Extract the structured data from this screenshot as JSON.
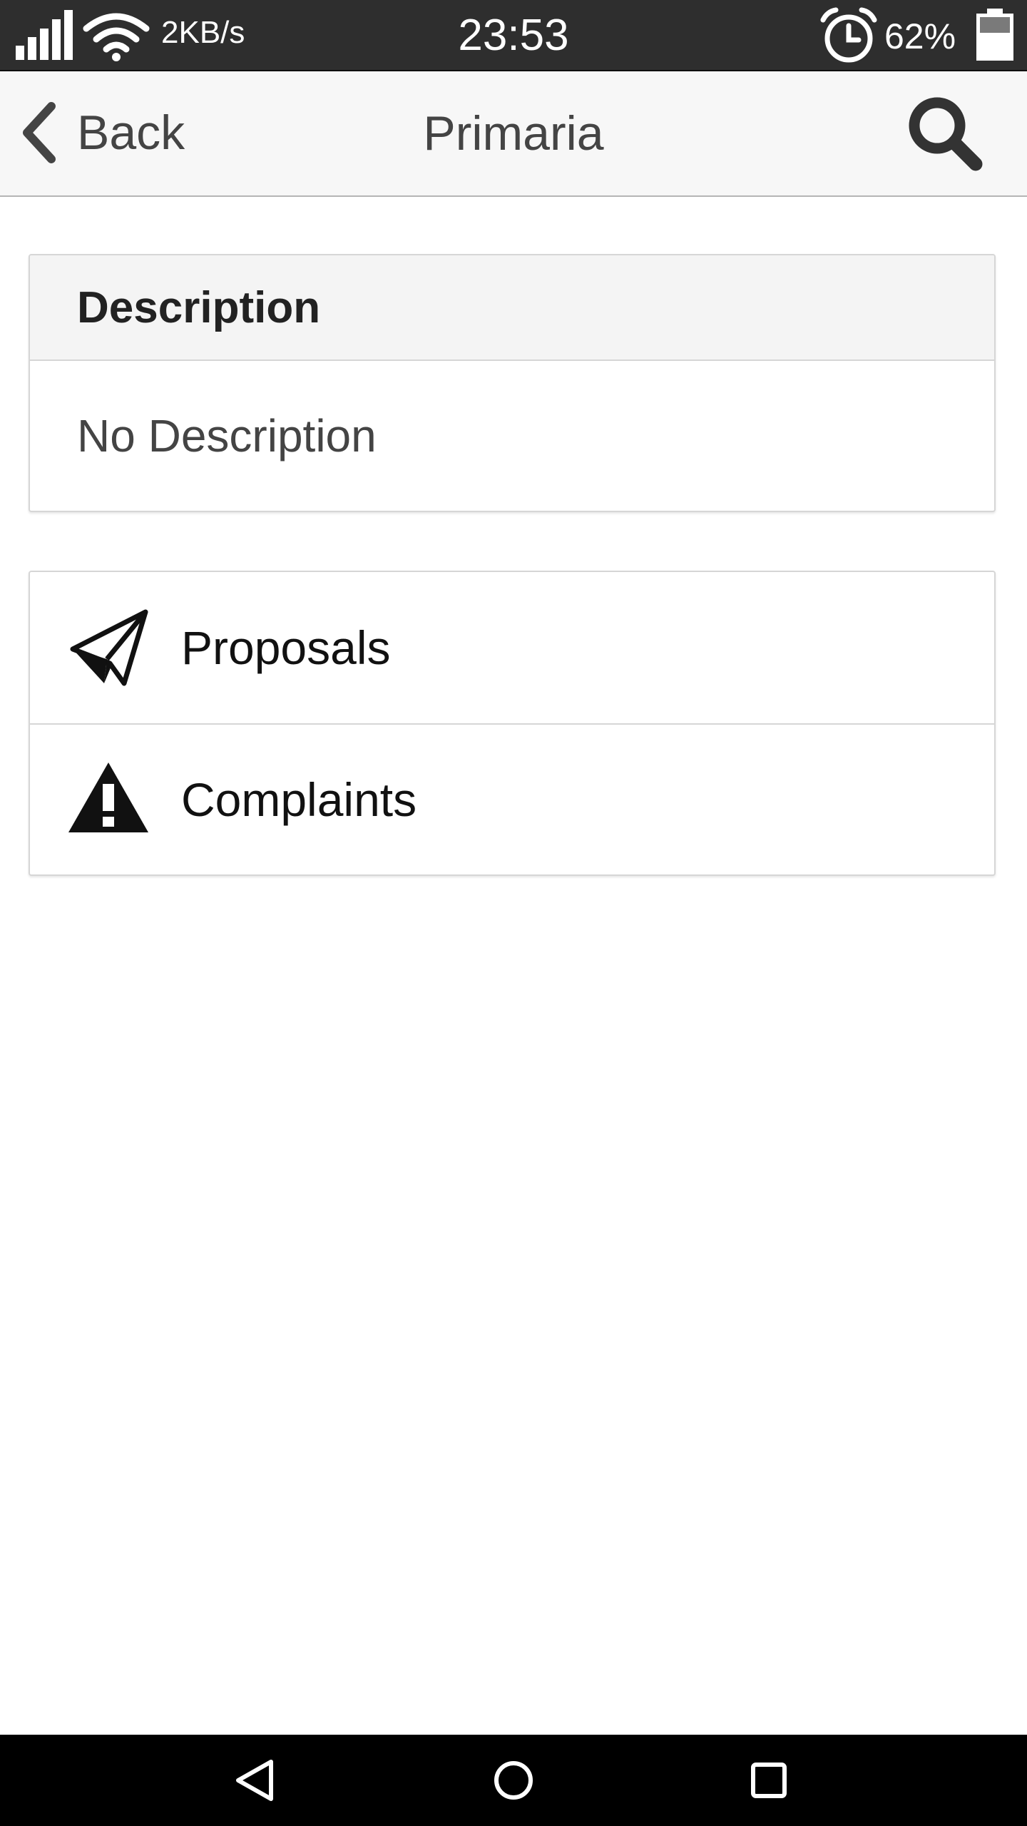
{
  "status_bar": {
    "net_speed": "2KB/s",
    "time": "23:53",
    "battery_percent": "62%",
    "icons": [
      "signal-icon",
      "wifi-icon",
      "alarm-clock-icon",
      "battery-icon"
    ]
  },
  "header": {
    "back_label": "Back",
    "title": "Primaria",
    "icons": [
      "chevron-left-icon",
      "search-icon"
    ]
  },
  "description": {
    "heading": "Description",
    "text": "No Description"
  },
  "menu": {
    "items": [
      {
        "label": "Proposals",
        "icon": "paper-plane-icon"
      },
      {
        "label": "Complaints",
        "icon": "warning-icon"
      }
    ]
  },
  "system_nav": {
    "icons": [
      "nav-back-icon",
      "nav-home-icon",
      "nav-recents-icon"
    ]
  }
}
